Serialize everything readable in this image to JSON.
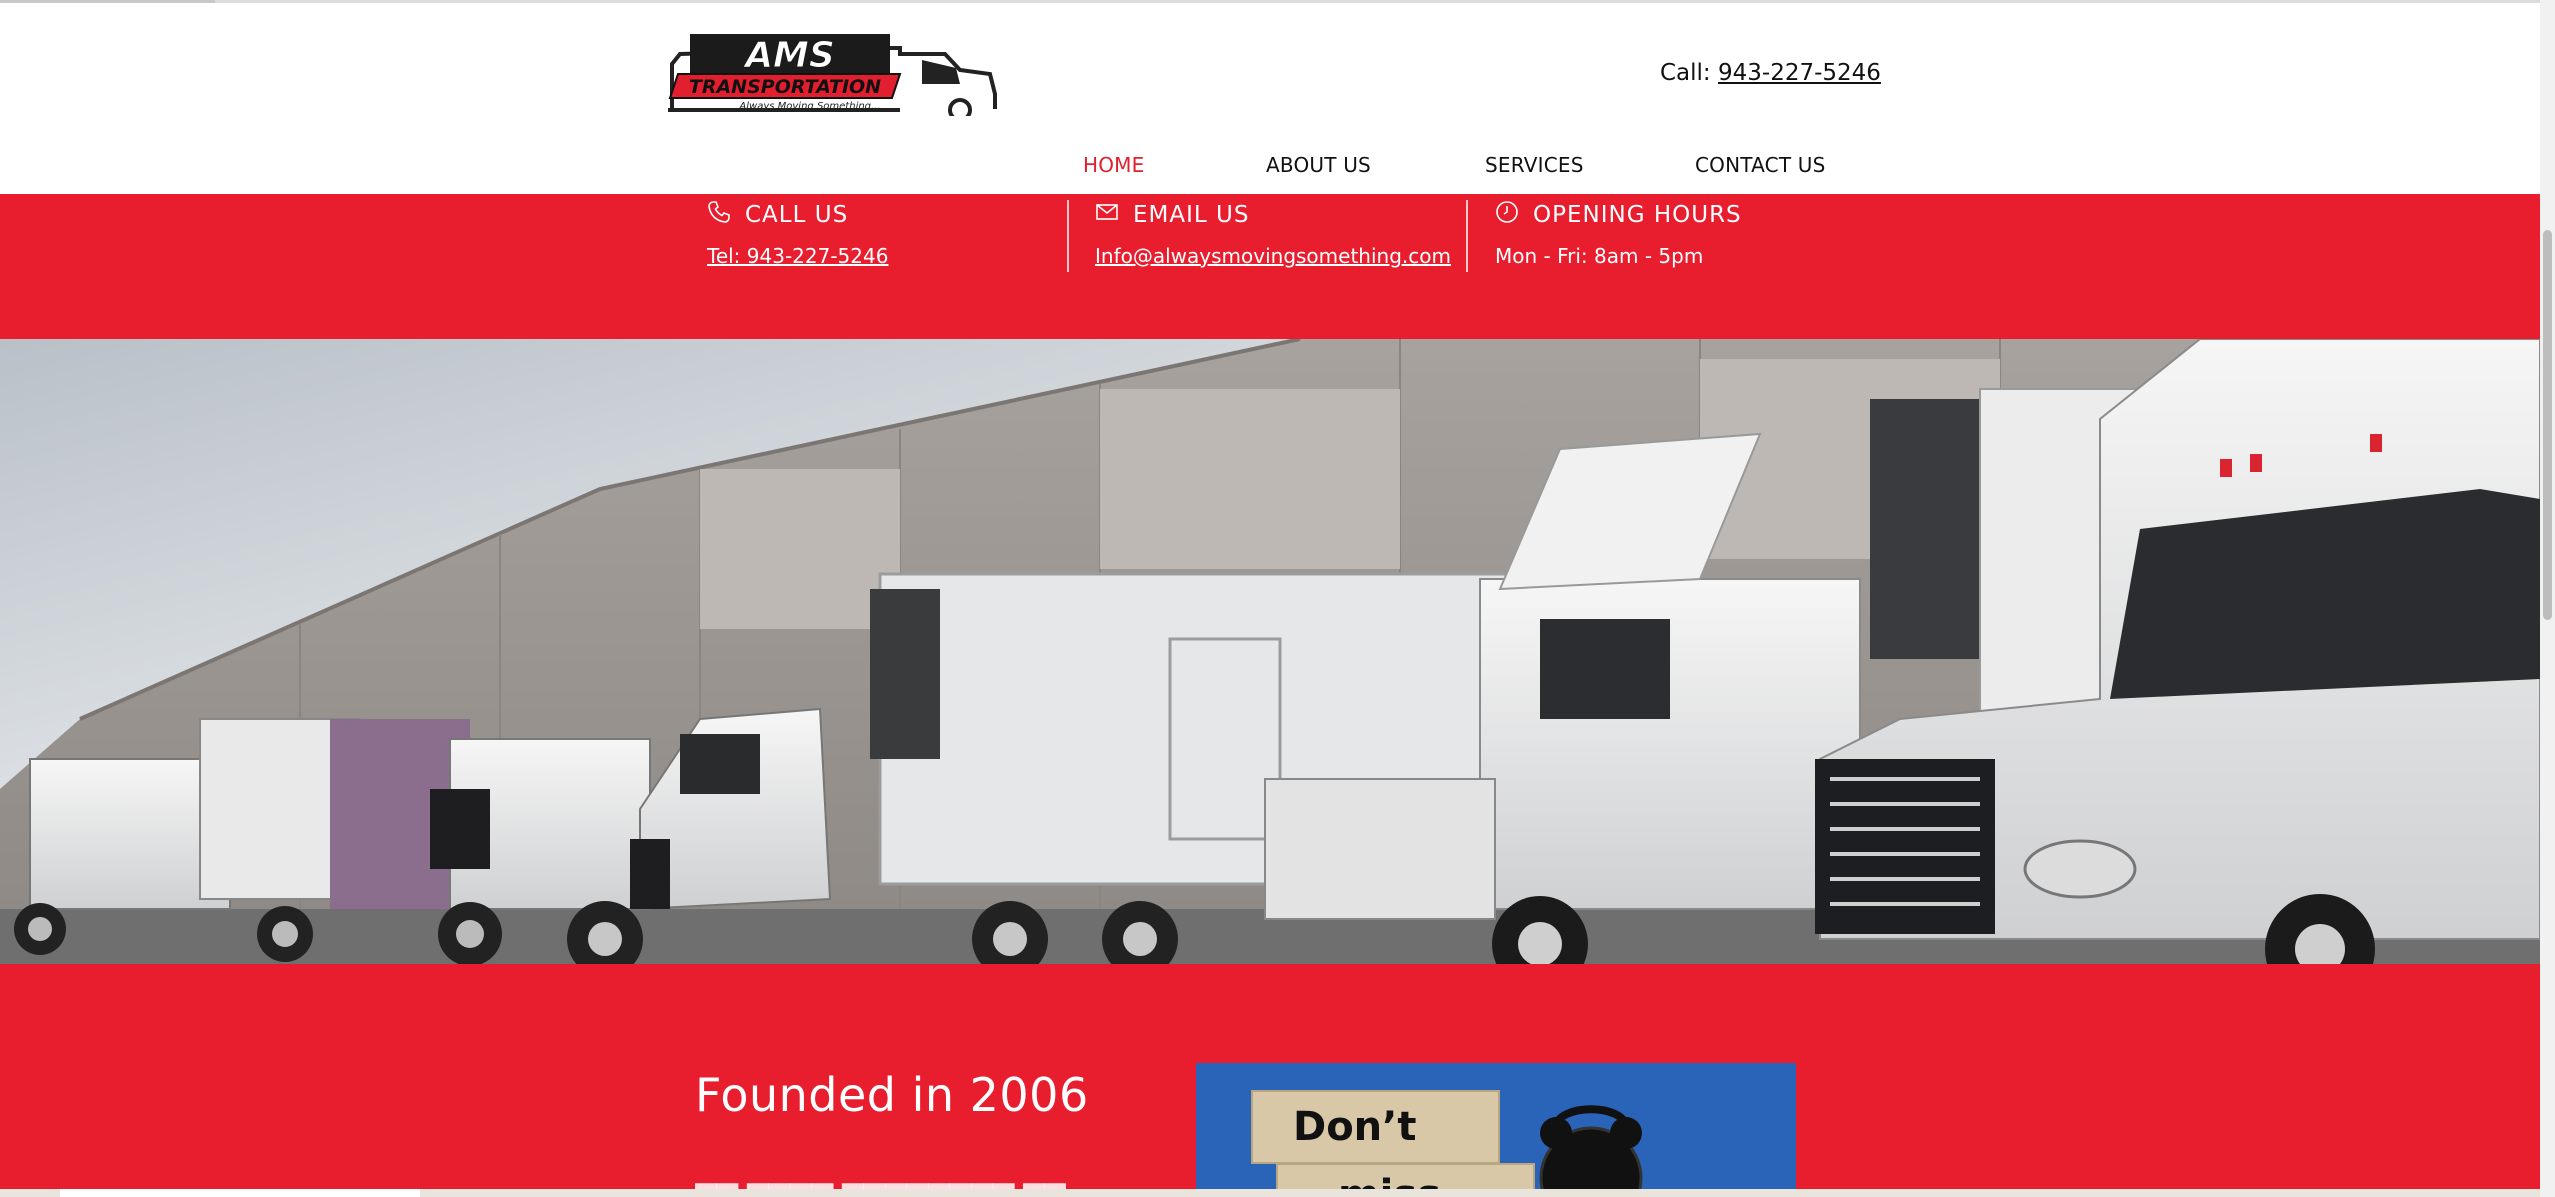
{
  "logo": {
    "brand": "AMS",
    "brand_sub": "TRANSPORTATION",
    "tagline": "Always Moving Something..."
  },
  "header": {
    "call_label": "Call:",
    "call_number": "943-227-5246"
  },
  "nav": {
    "items": [
      {
        "label": "HOME",
        "active": true
      },
      {
        "label": "ABOUT US",
        "active": false
      },
      {
        "label": "SERVICES",
        "active": false
      },
      {
        "label": "CONTACT US",
        "active": false
      }
    ]
  },
  "info": {
    "call": {
      "title": "CALL US",
      "value": "Tel: 943-227-5246",
      "icon": "phone-icon"
    },
    "email": {
      "title": "EMAIL US",
      "value": "Info@alwaysmovingsomething.com",
      "icon": "mail-icon"
    },
    "hours": {
      "title": "OPENING HOURS",
      "value": "Mon - Fri: 8am - 5pm",
      "icon": "clock-icon"
    }
  },
  "hero": {
    "image": "row of white semi trucks at warehouse loading docks"
  },
  "about": {
    "heading": "Founded in 2006",
    "promo_words": [
      "Don’t",
      "miss"
    ]
  },
  "colors": {
    "brand_red": "#e81e2f",
    "nav_active": "#e21f2e",
    "promo_blue": "#2a64b8"
  }
}
